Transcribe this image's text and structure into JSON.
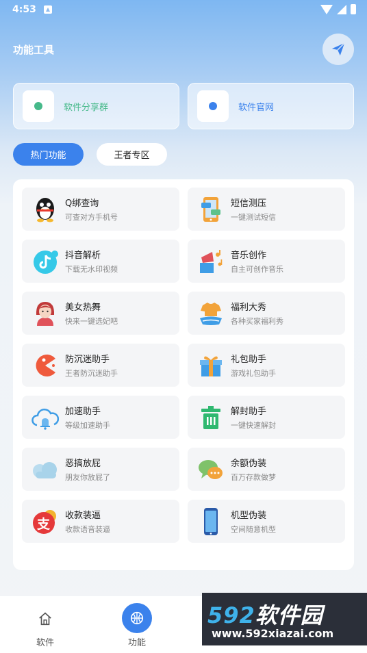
{
  "status_bar": {
    "time": "4:53"
  },
  "header": {
    "title": "功能工具"
  },
  "quick_links": [
    {
      "label": "软件分享群",
      "color": "#46b98a"
    },
    {
      "label": "软件官网",
      "color": "#3b82ec"
    }
  ],
  "tabs": [
    {
      "label": "热门功能",
      "active": true
    },
    {
      "label": "王者专区",
      "active": false
    }
  ],
  "features": [
    {
      "title": "Q绑查询",
      "subtitle": "可查对方手机号",
      "icon": "qq-penguin-icon"
    },
    {
      "title": "短信测压",
      "subtitle": "一键测试短信",
      "icon": "sms-phone-icon"
    },
    {
      "title": "抖音解析",
      "subtitle": "下载无水印视频",
      "icon": "tiktok-icon"
    },
    {
      "title": "音乐创作",
      "subtitle": "自主可创作音乐",
      "icon": "music-icon"
    },
    {
      "title": "美女热舞",
      "subtitle": "快来一键选妃吧",
      "icon": "girl-avatar-icon"
    },
    {
      "title": "福利大秀",
      "subtitle": "各种买家福利秀",
      "icon": "clothes-icon"
    },
    {
      "title": "防沉迷助手",
      "subtitle": "王者防沉迷助手",
      "icon": "pacman-icon"
    },
    {
      "title": "礼包助手",
      "subtitle": "游戏礼包助手",
      "icon": "gift-icon"
    },
    {
      "title": "加速助手",
      "subtitle": "等级加速助手",
      "icon": "cloud-bell-icon"
    },
    {
      "title": "解封助手",
      "subtitle": "一键快速解封",
      "icon": "trash-bin-icon"
    },
    {
      "title": "恶搞放屁",
      "subtitle": "朋友你放屁了",
      "icon": "cloud-icon"
    },
    {
      "title": "余额伪装",
      "subtitle": "百万存款做梦",
      "icon": "chat-bubbles-icon"
    },
    {
      "title": "收款装逼",
      "subtitle": "收款语音装逼",
      "icon": "alipay-icon"
    },
    {
      "title": "机型伪装",
      "subtitle": "空间随意机型",
      "icon": "smartphone-icon"
    }
  ],
  "bottom_nav": [
    {
      "label": "软件",
      "icon": "home-icon"
    },
    {
      "label": "功能",
      "icon": "basketball-icon"
    }
  ],
  "watermark": {
    "brand_digits": "592",
    "brand_text": "软件园",
    "url": "www.592xiazai.com"
  }
}
